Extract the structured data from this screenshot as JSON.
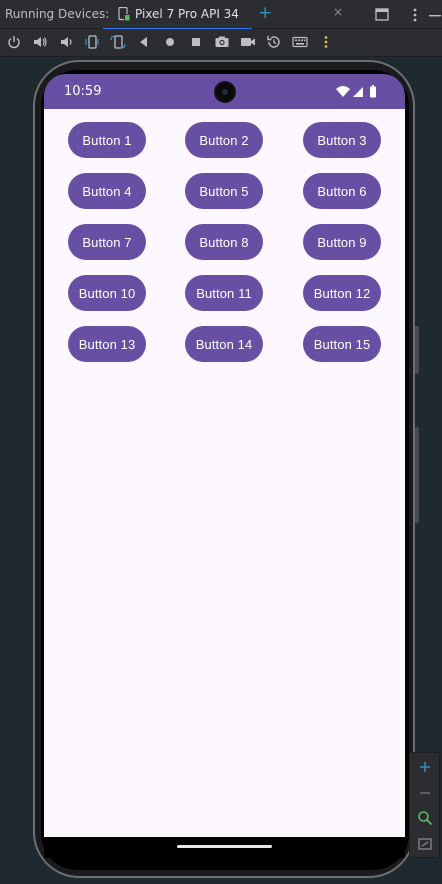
{
  "ide": {
    "tool_window_title": "Running Devices:",
    "device_tab_label": "Pixel 7 Pro API 34",
    "close_tab": "×",
    "add_tab": "+",
    "accent_color": "#3574f0"
  },
  "toolbar": {
    "icons": [
      "power-icon",
      "volume-up-icon",
      "volume-down-icon",
      "rotate-left-icon",
      "rotate-right-icon",
      "back-icon",
      "home-icon",
      "overview-icon",
      "screenshot-icon",
      "screen-record-icon",
      "snapshot-icon",
      "keyboard-icon",
      "more-icon"
    ]
  },
  "device": {
    "status_time": "10:59",
    "app_bar_color": "#6750a4",
    "background_color": "#fdf7ff"
  },
  "buttons": {
    "rows": [
      [
        "Button 1",
        "Button 2",
        "Button 3"
      ],
      [
        "Button 4",
        "Button 5",
        "Button 6"
      ],
      [
        "Button 7",
        "Button 8",
        "Button 9"
      ],
      [
        "Button 10",
        "Button 11",
        "Button 12"
      ],
      [
        "Button 13",
        "Button 14",
        "Button 15"
      ]
    ]
  },
  "zoom": {
    "icons": [
      "zoom-in-icon",
      "zoom-out-icon",
      "zoom-fit-icon",
      "zoom-actual-icon"
    ]
  }
}
